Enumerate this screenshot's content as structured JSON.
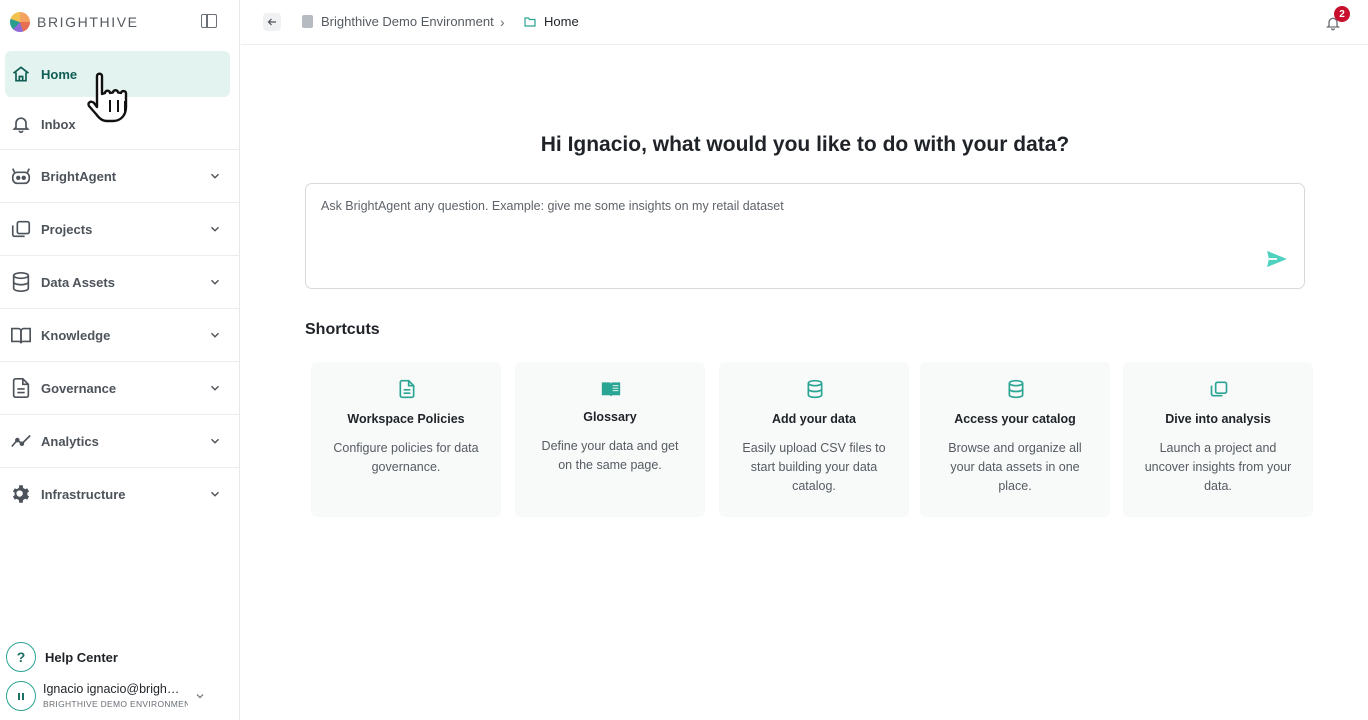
{
  "brand": {
    "name": "BRIGHTHIVE"
  },
  "sidebar": {
    "items": [
      {
        "label": "Home"
      },
      {
        "label": "Inbox"
      },
      {
        "label": "BrightAgent"
      },
      {
        "label": "Projects"
      },
      {
        "label": "Data Assets"
      },
      {
        "label": "Knowledge"
      },
      {
        "label": "Governance"
      },
      {
        "label": "Analytics"
      },
      {
        "label": "Infrastructure"
      }
    ],
    "help_label": "Help Center",
    "user": {
      "name": "Ignacio ignacio@brigh…",
      "environment": "BRIGHTHIVE DEMO ENVIRONMENT"
    }
  },
  "header": {
    "breadcrumb": [
      {
        "label": "Brighthive Demo Environment"
      },
      {
        "label": "Home"
      }
    ],
    "notification_count": "2"
  },
  "main": {
    "greeting": "Hi Ignacio, what would you like to do with your data?",
    "ask_placeholder": "Ask BrightAgent any question. Example: give me some insights on my retail dataset",
    "shortcuts_title": "Shortcuts",
    "shortcuts": [
      {
        "title": "Workspace Policies",
        "description": "Configure policies for data governance.",
        "icon": "document-icon"
      },
      {
        "title": "Glossary",
        "description": "Define your data and get on the same page.",
        "icon": "book-icon"
      },
      {
        "title": "Add your data",
        "description": "Easily upload CSV files to start building your data catalog.",
        "icon": "database-icon"
      },
      {
        "title": "Access your catalog",
        "description": "Browse and organize all your data assets in one place.",
        "icon": "database-icon"
      },
      {
        "title": "Dive into analysis",
        "description": "Launch a project and uncover insights from your data.",
        "icon": "copy-icon"
      }
    ]
  },
  "colors": {
    "accent": "#2aa493",
    "active_bg": "#e3f3f0",
    "active_text": "#0f5e54",
    "badge": "#c8102e",
    "send": "#4fd1c0"
  }
}
